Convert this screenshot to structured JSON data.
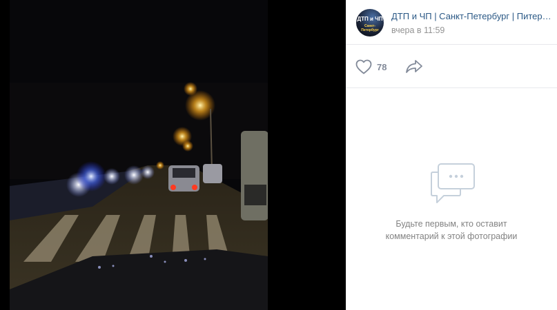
{
  "photo": {
    "description_icon": "night-road-photo"
  },
  "owner": {
    "name": "ДТП и ЧП | Санкт-Петербург | Питер Онлайн",
    "time": "вчера в 11:59",
    "avatar_text": "ДТП и ЧП",
    "avatar_sub": "Санкт-Петербург"
  },
  "actions": {
    "like_count": "78",
    "like_icon": "heart-icon",
    "share_icon": "share-arrow-icon"
  },
  "comments": {
    "empty_line1": "Будьте первым, кто оставит",
    "empty_line2": "комментарий к этой фотографии"
  },
  "colors": {
    "link": "#2a5885",
    "muted": "#939393",
    "icon": "#828a99",
    "divider": "#e7e8ec"
  }
}
